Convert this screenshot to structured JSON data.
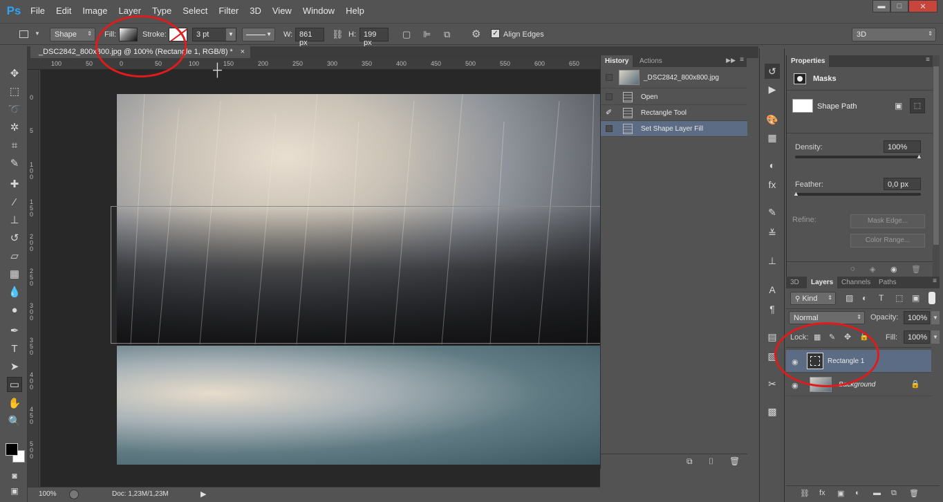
{
  "menubar": {
    "logo": "Ps",
    "items": [
      "File",
      "Edit",
      "Image",
      "Layer",
      "Type",
      "Select",
      "Filter",
      "3D",
      "View",
      "Window",
      "Help"
    ],
    "window_controls": {
      "minimize": "▬",
      "maximize": "□",
      "close": "✕"
    }
  },
  "options_bar": {
    "mode": "Shape",
    "fill_label": "Fill:",
    "stroke_label": "Stroke:",
    "stroke_width": "3 pt",
    "w_label": "W:",
    "w_value": "861 px",
    "h_label": "H:",
    "h_value": "199 px",
    "align_edges": "Align Edges",
    "workspace": "3D"
  },
  "document": {
    "tab_title": "_DSC2842_800x800.jpg @ 100% (Rectangle 1, RGB/8) *",
    "close": "×"
  },
  "ruler": {
    "h_ticks": [
      "100",
      "50",
      "0",
      "50",
      "100",
      "150",
      "200",
      "250",
      "300",
      "350",
      "400",
      "450",
      "500",
      "550",
      "600",
      "650"
    ],
    "v_ticks": [
      "0",
      "5",
      "1 0 0",
      "1 5 0",
      "2 0 0",
      "2 5 0",
      "3 0 0",
      "3 5 0",
      "4 0 0",
      "4 5 0",
      "5 0 0"
    ]
  },
  "status": {
    "zoom": "100%",
    "doc": "Doc: 1,23M/1,23M"
  },
  "history_panel": {
    "tabs": [
      "History",
      "Actions"
    ],
    "snapshot": "_DSC2842_800x800.jpg",
    "states": [
      "Open",
      "Rectangle Tool",
      "Set Shape Layer Fill"
    ]
  },
  "properties_panel": {
    "tab": "Properties",
    "section": "Masks",
    "shape_path": "Shape Path",
    "density_label": "Density:",
    "density_value": "100%",
    "feather_label": "Feather:",
    "feather_value": "0,0 px",
    "refine_label": "Refine:",
    "mask_edge": "Mask Edge...",
    "color_range": "Color Range..."
  },
  "layers_panel": {
    "tabs": [
      "3D",
      "Layers",
      "Channels",
      "Paths"
    ],
    "kind": "Kind",
    "blend_mode": "Normal",
    "opacity_label": "Opacity:",
    "opacity_value": "100%",
    "lock_label": "Lock:",
    "fill_label": "Fill:",
    "fill_value": "100%",
    "layers": [
      {
        "name": "Rectangle 1",
        "selected": true
      },
      {
        "name": "Background",
        "selected": false
      }
    ]
  },
  "colors": {
    "accent": "#2fa3f7",
    "selection": "#5b6c84",
    "annotation": "#e01b1b"
  }
}
